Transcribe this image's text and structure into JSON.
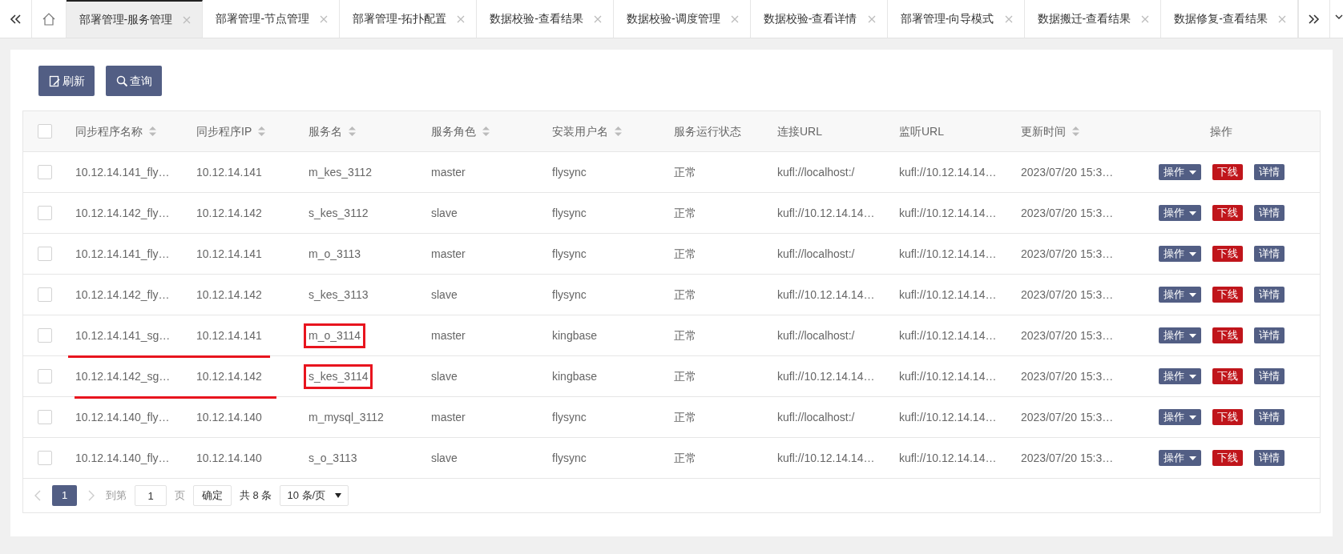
{
  "tabs": [
    {
      "label": "部署管理-服务管理",
      "selected": true
    },
    {
      "label": "部署管理-节点管理",
      "selected": false
    },
    {
      "label": "部署管理-拓扑配置",
      "selected": false
    },
    {
      "label": "数据校验-查看结果",
      "selected": false
    },
    {
      "label": "数据校验-调度管理",
      "selected": false
    },
    {
      "label": "数据校验-查看详情",
      "selected": false
    },
    {
      "label": "部署管理-向导模式",
      "selected": false
    },
    {
      "label": "数据搬迁-查看结果",
      "selected": false
    },
    {
      "label": "数据修复-查看结果",
      "selected": false
    }
  ],
  "toolbar": [
    {
      "label": "刷新",
      "kind": "refresh"
    },
    {
      "label": "查询",
      "kind": "search"
    }
  ],
  "table": {
    "select_all_checked": false,
    "columns": [
      {
        "label": "同步程序名称",
        "sortable": true
      },
      {
        "label": "同步程序IP",
        "sortable": true
      },
      {
        "label": "服务名",
        "sortable": true
      },
      {
        "label": "服务角色",
        "sortable": true
      },
      {
        "label": "安装用户名",
        "sortable": true
      },
      {
        "label": "服务运行状态",
        "sortable": false
      },
      {
        "label": "连接URL",
        "sortable": false
      },
      {
        "label": "监听URL",
        "sortable": false
      },
      {
        "label": "更新时间",
        "sortable": true
      },
      {
        "label": "操作",
        "sortable": false
      }
    ],
    "rows": [
      {
        "checked": false,
        "underlined": false,
        "boxed": false,
        "cells": [
          "10.12.14.141_fly…",
          "10.12.14.141",
          "m_kes_3112",
          "master",
          "flysync",
          "正常",
          "kufl://localhost:/",
          "kufl://10.12.14.14…",
          "2023/07/20 15:3…"
        ],
        "actions": [
          "操作",
          "下线",
          "详情"
        ]
      },
      {
        "checked": false,
        "underlined": false,
        "boxed": false,
        "cells": [
          "10.12.14.142_fly…",
          "10.12.14.142",
          "s_kes_3112",
          "slave",
          "flysync",
          "正常",
          "kufl://10.12.14.14…",
          "kufl://10.12.14.14…",
          "2023/07/20 15:3…"
        ],
        "actions": [
          "操作",
          "下线",
          "详情"
        ]
      },
      {
        "checked": false,
        "underlined": false,
        "boxed": false,
        "cells": [
          "10.12.14.141_fly…",
          "10.12.14.141",
          "m_o_3113",
          "master",
          "flysync",
          "正常",
          "kufl://localhost:/",
          "kufl://10.12.14.14…",
          "2023/07/20 15:3…"
        ],
        "actions": [
          "操作",
          "下线",
          "详情"
        ]
      },
      {
        "checked": false,
        "underlined": false,
        "boxed": false,
        "cells": [
          "10.12.14.142_fly…",
          "10.12.14.142",
          "s_kes_3113",
          "slave",
          "flysync",
          "正常",
          "kufl://10.12.14.14…",
          "kufl://10.12.14.14…",
          "2023/07/20 15:3…"
        ],
        "actions": [
          "操作",
          "下线",
          "详情"
        ]
      },
      {
        "checked": false,
        "underlined": true,
        "boxed": true,
        "cells": [
          "10.12.14.141_sg…",
          "10.12.14.141",
          "m_o_3114",
          "master",
          "kingbase",
          "正常",
          "kufl://localhost:/",
          "kufl://10.12.14.14…",
          "2023/07/20 15:3…"
        ],
        "actions": [
          "操作",
          "下线",
          "详情"
        ]
      },
      {
        "checked": false,
        "underlined": true,
        "boxed": true,
        "cells": [
          "10.12.14.142_sg…",
          "10.12.14.142",
          "s_kes_3114",
          "slave",
          "kingbase",
          "正常",
          "kufl://10.12.14.14…",
          "kufl://10.12.14.14…",
          "2023/07/20 15:3…"
        ],
        "actions": [
          "操作",
          "下线",
          "详情"
        ]
      },
      {
        "checked": false,
        "underlined": false,
        "boxed": false,
        "cells": [
          "10.12.14.140_fly…",
          "10.12.14.140",
          "m_mysql_3112",
          "master",
          "flysync",
          "正常",
          "kufl://localhost:/",
          "kufl://10.12.14.14…",
          "2023/07/20 15:3…"
        ],
        "actions": [
          "操作",
          "下线",
          "详情"
        ]
      },
      {
        "checked": false,
        "underlined": false,
        "boxed": false,
        "cells": [
          "10.12.14.140_fly…",
          "10.12.14.140",
          "s_o_3113",
          "slave",
          "flysync",
          "正常",
          "kufl://10.12.14.14…",
          "kufl://10.12.14.14…",
          "2023/07/20 15:3…"
        ],
        "actions": [
          "操作",
          "下线",
          "详情"
        ]
      }
    ]
  },
  "pagination": {
    "pages": [
      {
        "label": "1",
        "selected": true
      }
    ],
    "goto_label": "到第",
    "page_value": "1",
    "page_unit": "页",
    "confirm": "确定",
    "total": "共 8 条",
    "page_size": "10 条/页"
  }
}
